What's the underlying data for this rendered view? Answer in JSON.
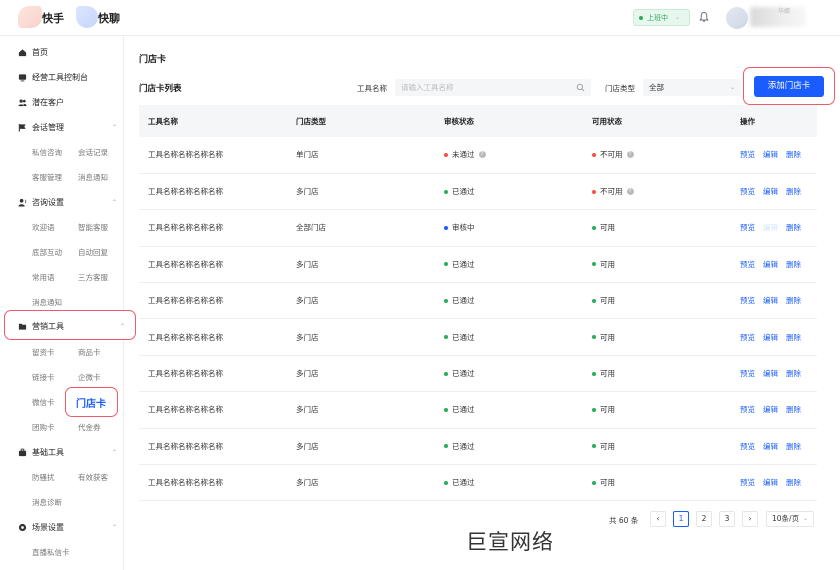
{
  "brand": {
    "app1": "快手",
    "app2": "快聊"
  },
  "header": {
    "status": "上班中",
    "user": "华娜"
  },
  "sidebar": {
    "home": "首页",
    "console": "经营工具控制台",
    "leads": "潜在客户",
    "session": {
      "label": "会话管理",
      "items": [
        "私信咨询",
        "会话记录",
        "客服管理",
        "消息通知"
      ]
    },
    "consult": {
      "label": "咨询设置",
      "items": [
        "欢迎语",
        "智能客服",
        "底部互动",
        "自动回复",
        "常用语",
        "三方客服",
        "消息通知"
      ]
    },
    "marketing": {
      "label": "营销工具",
      "items": [
        "留资卡",
        "商品卡",
        "链接卡",
        "企微卡",
        "微信卡",
        "门店卡",
        "团购卡",
        "代金券"
      ]
    },
    "basic": {
      "label": "基础工具",
      "items": [
        "防骚扰",
        "有效获客",
        "消息诊断"
      ]
    },
    "scene": {
      "label": "场景设置",
      "items": [
        "直播私信卡"
      ]
    }
  },
  "main": {
    "page_title": "门店卡",
    "list_title": "门店卡列表",
    "filter_name_label": "工具名称",
    "filter_name_placeholder": "请输入工具名称",
    "filter_type_label": "门店类型",
    "filter_type_value": "全部",
    "add_button": "添加门店卡",
    "columns": [
      "工具名称",
      "门店类型",
      "审核状态",
      "可用状态",
      "操作"
    ],
    "actions": [
      "预览",
      "编辑",
      "删除"
    ],
    "rows": [
      {
        "name": "工具名称名称名称名称",
        "type": "单门店",
        "audit": "未通过",
        "audit_color": "#f5543d",
        "audit_help": true,
        "avail": "不可用",
        "avail_color": "#f5543d",
        "avail_help": true
      },
      {
        "name": "工具名称名称名称名称",
        "type": "多门店",
        "audit": "已通过",
        "audit_color": "#2bad5c",
        "audit_help": false,
        "avail": "不可用",
        "avail_color": "#f5543d",
        "avail_help": true
      },
      {
        "name": "工具名称名称名称名称",
        "type": "全部门店",
        "audit": "审核中",
        "audit_color": "#1a5cff",
        "audit_help": false,
        "avail": "可用",
        "avail_color": "#2bad5c",
        "avail_help": false
      },
      {
        "name": "工具名称名称名称名称",
        "type": "多门店",
        "audit": "已通过",
        "audit_color": "#2bad5c",
        "audit_help": false,
        "avail": "可用",
        "avail_color": "#2bad5c",
        "avail_help": false
      },
      {
        "name": "工具名称名称名称名称",
        "type": "多门店",
        "audit": "已通过",
        "audit_color": "#2bad5c",
        "audit_help": false,
        "avail": "可用",
        "avail_color": "#2bad5c",
        "avail_help": false
      },
      {
        "name": "工具名称名称名称名称",
        "type": "多门店",
        "audit": "已通过",
        "audit_color": "#2bad5c",
        "audit_help": false,
        "avail": "可用",
        "avail_color": "#2bad5c",
        "avail_help": false
      },
      {
        "name": "工具名称名称名称名称",
        "type": "多门店",
        "audit": "已通过",
        "audit_color": "#2bad5c",
        "audit_help": false,
        "avail": "可用",
        "avail_color": "#2bad5c",
        "avail_help": false
      },
      {
        "name": "工具名称名称名称名称",
        "type": "多门店",
        "audit": "已通过",
        "audit_color": "#2bad5c",
        "audit_help": false,
        "avail": "可用",
        "avail_color": "#2bad5c",
        "avail_help": false
      },
      {
        "name": "工具名称名称名称名称",
        "type": "多门店",
        "audit": "已通过",
        "audit_color": "#2bad5c",
        "audit_help": false,
        "avail": "可用",
        "avail_color": "#2bad5c",
        "avail_help": false
      },
      {
        "name": "工具名称名称名称名称",
        "type": "多门店",
        "audit": "已通过",
        "audit_color": "#2bad5c",
        "audit_help": false,
        "avail": "可用",
        "avail_color": "#2bad5c",
        "avail_help": false
      }
    ],
    "pagination": {
      "total": "共 60 条",
      "prev": "‹",
      "next": "›",
      "pages": [
        "1",
        "2",
        "3"
      ],
      "current": "1",
      "page_size": "10条/页"
    }
  },
  "watermark": "巨宣网络"
}
